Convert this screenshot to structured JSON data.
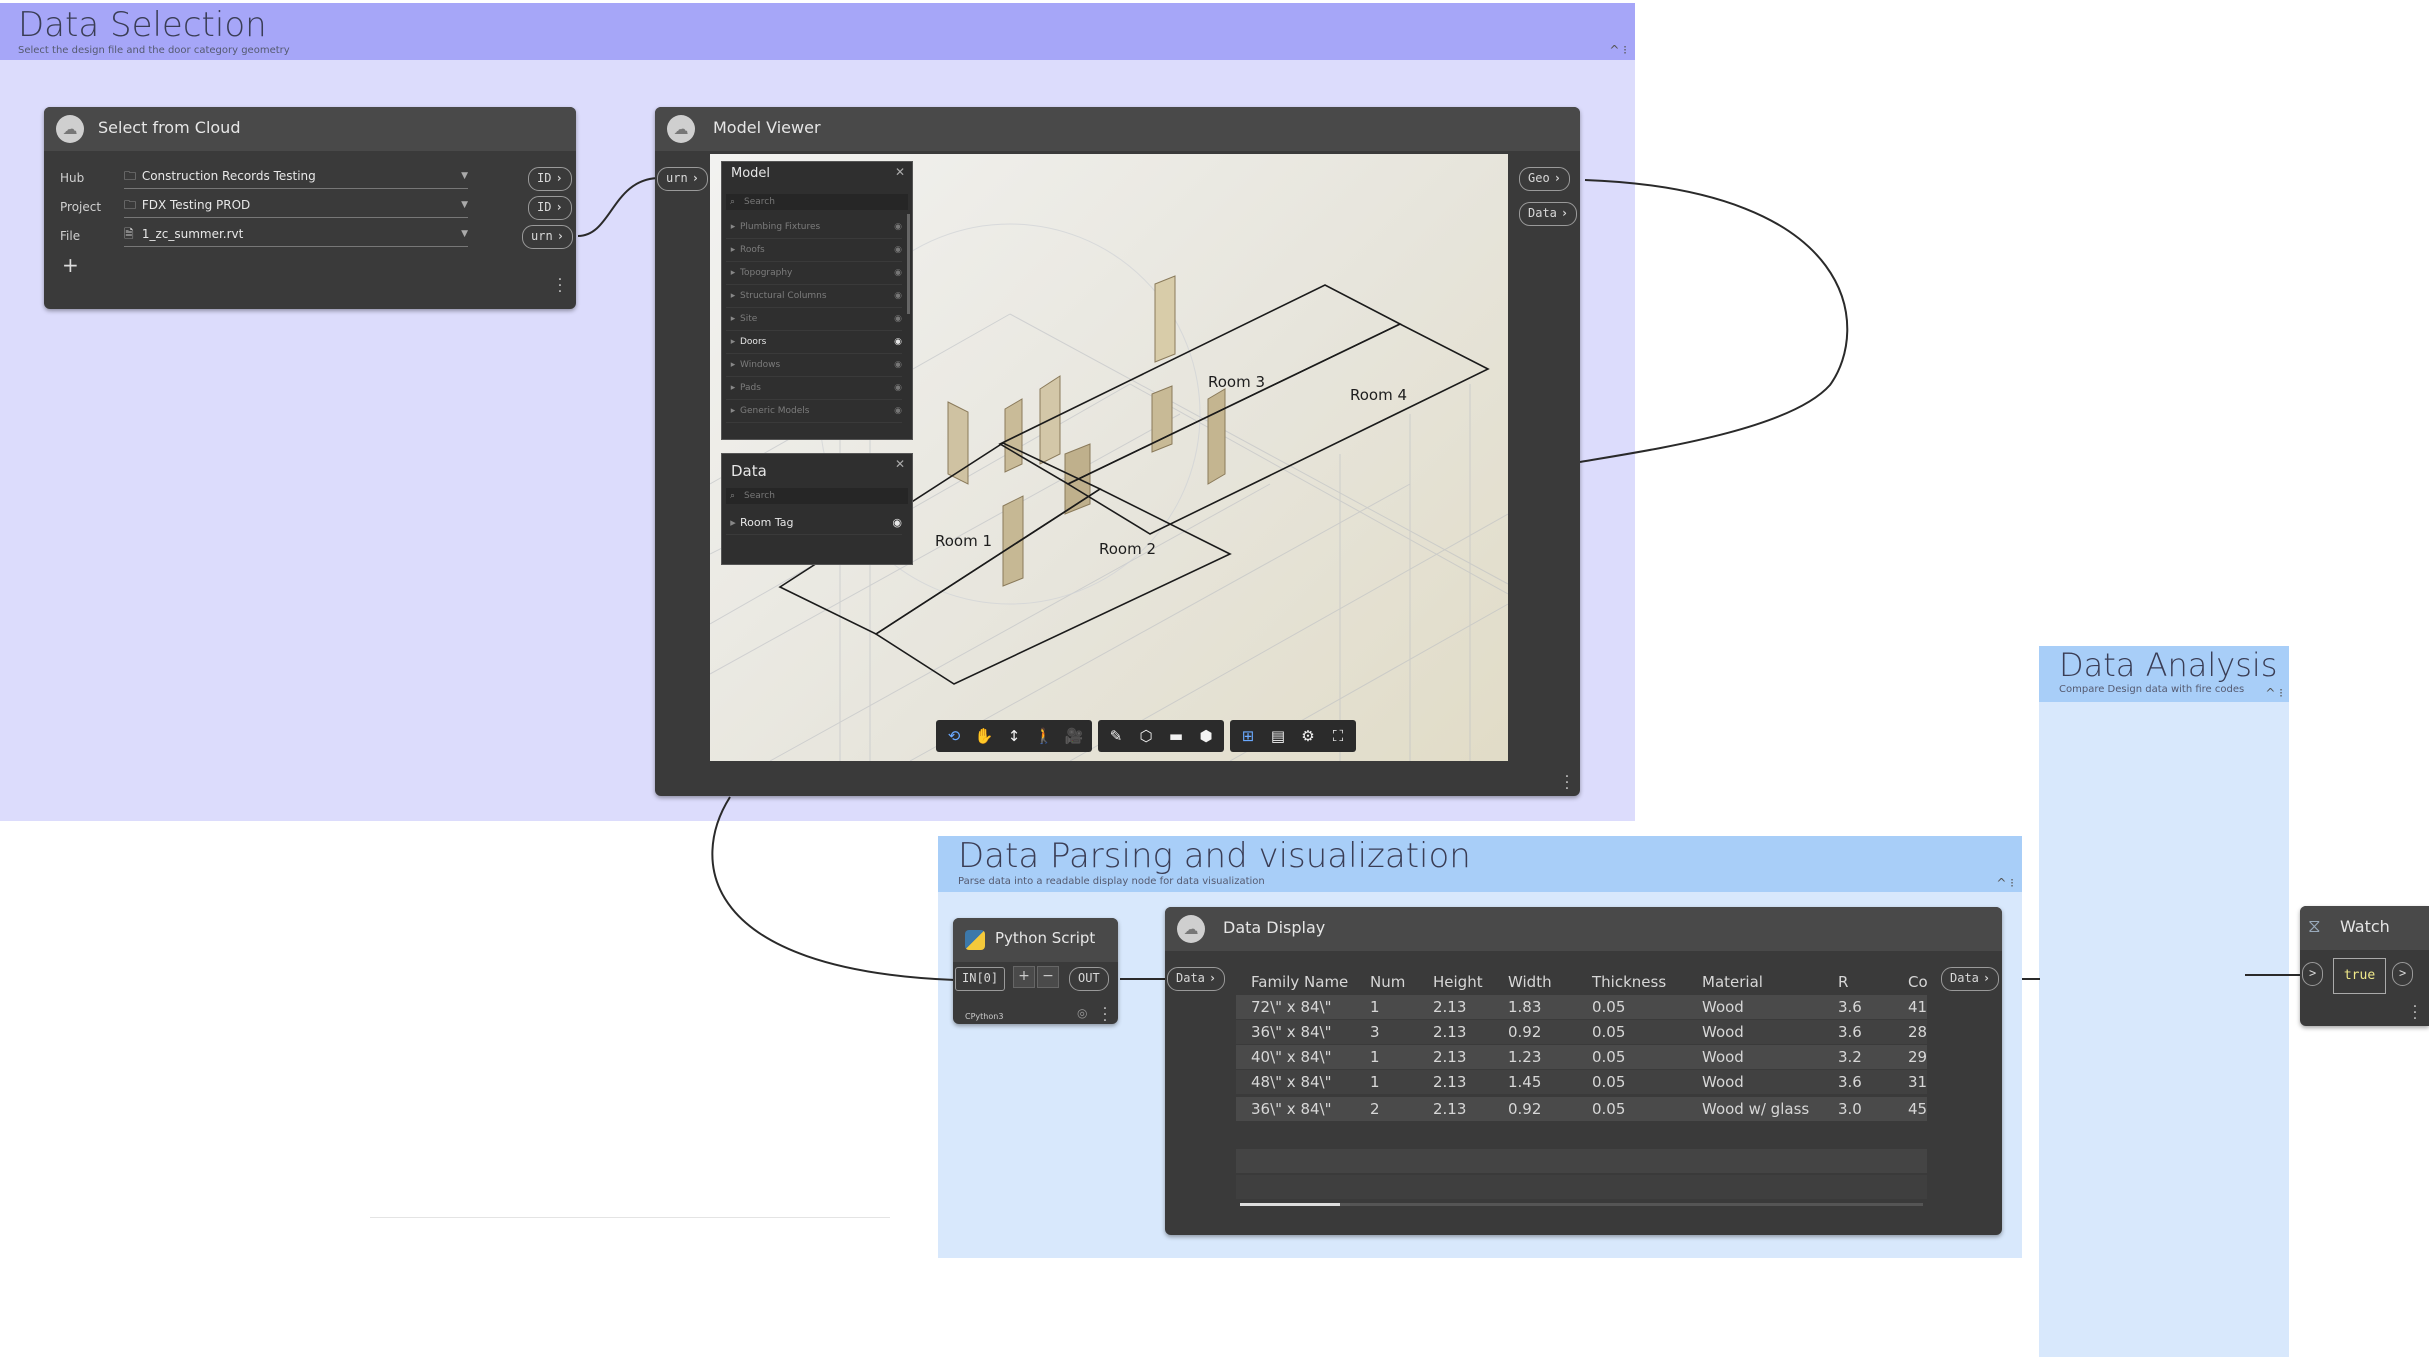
{
  "groups": {
    "selection": {
      "title": "Data Selection",
      "description": "Select the design file and the door category geometry",
      "collapse": "^ ⁝"
    },
    "parsing": {
      "title": "Data Parsing and visualization",
      "description": "Parse data into a readable display node for data visualization",
      "collapse": "^ ⁝"
    },
    "analysis": {
      "title": "Data Analysis",
      "description": "Compare Design data with fire codes",
      "collapse": "^ ⁝"
    }
  },
  "select_node": {
    "title": "Select from Cloud",
    "fields": [
      {
        "label": "Hub",
        "value": "Construction Records Testing",
        "icon": "folder-icon",
        "port": "ID"
      },
      {
        "label": "Project",
        "value": "FDX Testing PROD",
        "icon": "folder-icon",
        "port": "ID"
      },
      {
        "label": "File",
        "value": "1_zc_summer.rvt",
        "icon": "file-icon",
        "port": "urn"
      }
    ],
    "add_label": "+"
  },
  "viewer_node": {
    "title": "Model Viewer",
    "input_port": "urn",
    "output_ports": [
      "Geo",
      "Data"
    ],
    "model_panel": {
      "title": "Model",
      "search_placeholder": "Search",
      "items": [
        {
          "label": "Plumbing Fixtures",
          "active": false
        },
        {
          "label": "Roofs",
          "active": false
        },
        {
          "label": "Topography",
          "active": false
        },
        {
          "label": "Structural Columns",
          "active": false
        },
        {
          "label": "Site",
          "active": false
        },
        {
          "label": "Doors",
          "active": true
        },
        {
          "label": "Windows",
          "active": false
        },
        {
          "label": "Pads",
          "active": false
        },
        {
          "label": "Generic Models",
          "active": false
        }
      ]
    },
    "data_panel": {
      "title": "Data",
      "search_placeholder": "Search",
      "items": [
        {
          "label": "Room Tag",
          "active": true
        }
      ]
    },
    "rooms": [
      "Room 1",
      "Room 2",
      "Room 3",
      "Room 4"
    ],
    "toolbar_groups": [
      [
        "orbit-icon",
        "pan-icon",
        "zoom-icon",
        "walk-icon",
        "camera-icon"
      ],
      [
        "measure-icon",
        "section-icon",
        "explode-icon",
        "model-browser-icon"
      ],
      [
        "structure-icon",
        "properties-icon",
        "settings-icon",
        "fullscreen-icon"
      ]
    ]
  },
  "python_node": {
    "title": "Python Script",
    "input_port": "IN[0]",
    "output_port": "OUT",
    "add": "+",
    "remove": "−",
    "engine": "CPython3"
  },
  "display_node": {
    "title": "Data Display",
    "input_port": "Data",
    "output_port": "Data",
    "columns": [
      "Family Name",
      "Num",
      "Height",
      "Width",
      "Thickness",
      "Material",
      "R",
      "Co"
    ],
    "rows": [
      [
        "72\\\" x 84\\\"",
        "1",
        "2.13",
        "1.83",
        "0.05",
        "Wood",
        "3.6",
        "41."
      ],
      [
        "36\\\" x 84\\\"",
        "3",
        "2.13",
        "0.92",
        "0.05",
        "Wood",
        "3.6",
        "28"
      ],
      [
        "40\\\" x 84\\\"",
        "1",
        "2.13",
        "1.23",
        "0.05",
        "Wood",
        "3.2",
        "29"
      ],
      [
        "48\\\" x 84\\\"",
        "1",
        "2.13",
        "1.45",
        "0.05",
        "Wood",
        "3.6",
        "31."
      ],
      [
        "36\\\" x 84\\\"",
        "2",
        "2.13",
        "0.92",
        "0.05",
        "Wood w/ glass",
        "3.0",
        "45"
      ]
    ]
  },
  "watch_node": {
    "title": "Watch",
    "value": "true",
    "input_port": ">",
    "output_port": ">"
  },
  "colors": {
    "selection_group": "#dcdcfc",
    "selection_header": "#a6a6f8",
    "parsing_group": "#d8e8fc",
    "parsing_header": "#a8cef8",
    "node_body": "#3a3a3a",
    "node_header": "#494949"
  }
}
